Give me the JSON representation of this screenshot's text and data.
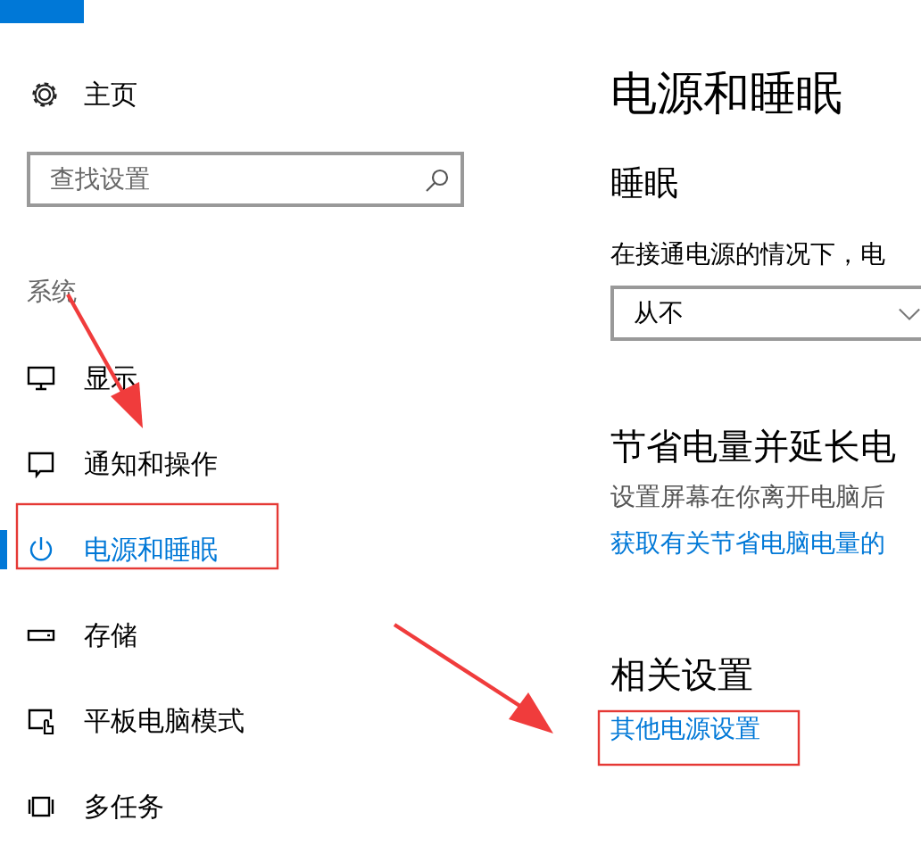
{
  "sidebar": {
    "home": "主页",
    "search": {
      "placeholder": "查找设置"
    },
    "section": "系统",
    "items": [
      {
        "label": "显示",
        "kind": "monitor",
        "selected": false
      },
      {
        "label": "通知和操作",
        "kind": "message",
        "selected": false
      },
      {
        "label": "电源和睡眠",
        "kind": "power",
        "selected": true
      },
      {
        "label": "存储",
        "kind": "drive",
        "selected": false
      },
      {
        "label": "平板电脑模式",
        "kind": "tablet",
        "selected": false
      },
      {
        "label": "多任务",
        "kind": "multitask",
        "selected": false
      }
    ]
  },
  "content": {
    "title": "电源和睡眠",
    "sleep": {
      "heading": "睡眠",
      "description": "在接通电源的情况下，电",
      "dropdown": {
        "value": "从不"
      }
    },
    "battery": {
      "heading": "节省电量并延长电",
      "description": "设置屏幕在你离开电脑后",
      "link": "获取有关节省电脑电量的"
    },
    "related": {
      "heading": "相关设置",
      "link": "其他电源设置"
    }
  }
}
